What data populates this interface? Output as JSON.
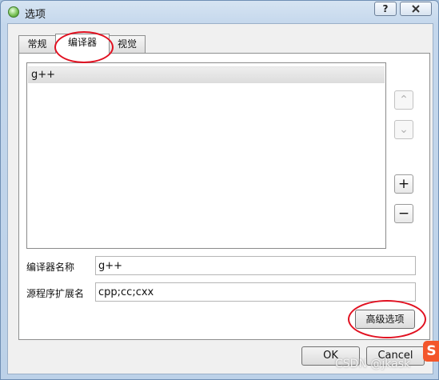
{
  "window": {
    "title": "选项",
    "help_label": "?"
  },
  "tabs": [
    {
      "label": "常规"
    },
    {
      "label": "编译器"
    },
    {
      "label": "视觉"
    }
  ],
  "compiler_list": {
    "items": [
      "g++"
    ]
  },
  "side_buttons": {
    "up": "⌃",
    "down": "⌄",
    "add": "+",
    "remove": "−"
  },
  "fields": {
    "name_label": "编译器名称",
    "name_value": "g++",
    "ext_label": "源程序扩展名",
    "ext_value": "cpp;cc;cxx"
  },
  "buttons": {
    "advanced": "高级选项",
    "ok": "OK",
    "cancel": "Cancel"
  },
  "watermark": "CSDN @jkask",
  "badge": "S",
  "colors": {
    "annotation": "#e11020",
    "badge": "#f3562b"
  }
}
